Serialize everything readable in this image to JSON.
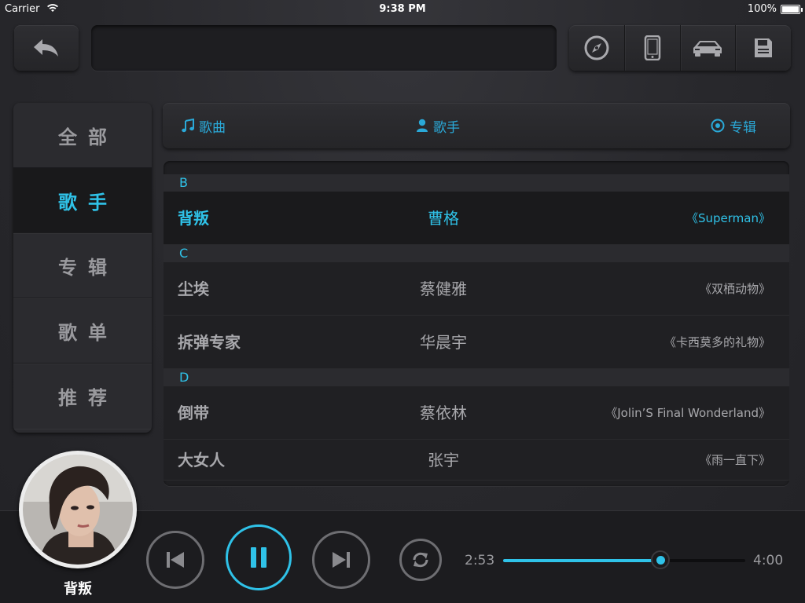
{
  "status_bar": {
    "carrier": "Carrier",
    "time": "9:38 PM",
    "battery": "100%"
  },
  "toolbar": {
    "back_icon": "back-arrow-icon",
    "title": "",
    "tools": [
      "compass-icon",
      "phone-icon",
      "car-icon",
      "save-icon"
    ]
  },
  "sidebar": {
    "items": [
      {
        "label": "全部",
        "active": false
      },
      {
        "label": "歌手",
        "active": true
      },
      {
        "label": "专辑",
        "active": false
      },
      {
        "label": "歌单",
        "active": false
      },
      {
        "label": "推荐",
        "active": false
      }
    ]
  },
  "tabs": [
    {
      "label": "歌曲",
      "icon": "music-note-icon"
    },
    {
      "label": "歌手",
      "icon": "person-icon"
    },
    {
      "label": "专辑",
      "icon": "disc-icon"
    }
  ],
  "list": {
    "groups": [
      {
        "letter": "B",
        "rows": [
          {
            "song": "背叛",
            "artist": "曹格",
            "album": "《Superman》",
            "selected": true
          }
        ]
      },
      {
        "letter": "C",
        "rows": [
          {
            "song": "尘埃",
            "artist": "蔡健雅",
            "album": "《双栖动物》",
            "selected": false
          },
          {
            "song": "拆弹专家",
            "artist": "华晨宇",
            "album": "《卡西莫多的礼物》",
            "selected": false
          }
        ]
      },
      {
        "letter": "D",
        "rows": [
          {
            "song": "倒带",
            "artist": "蔡依林",
            "album": "《Jolin’S Final Wonderland》",
            "selected": false
          },
          {
            "song": "大女人",
            "artist": "张宇",
            "album": "《雨一直下》",
            "selected": false
          }
        ]
      }
    ]
  },
  "player": {
    "now_playing": "背叛",
    "current_time": "2:53",
    "total_time": "4:00",
    "progress": 0.65,
    "state_icon": "pause-icon"
  },
  "colors": {
    "accent": "#2fc2e8",
    "tab": "#2aa9d8",
    "background": "#2a2a2e"
  }
}
